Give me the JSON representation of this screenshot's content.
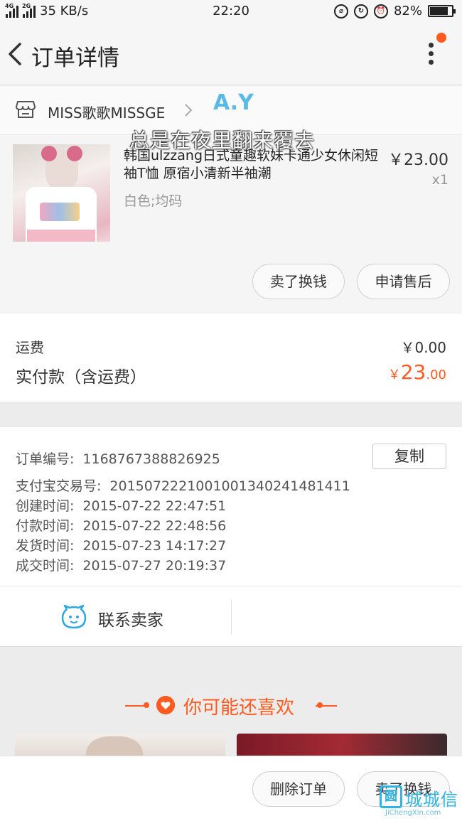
{
  "status_bar": {
    "network": "4G",
    "network2": "2G",
    "speed": "35 KB/s",
    "time": "22:20",
    "battery": "82%",
    "battery_level": 0.82
  },
  "nav": {
    "title": "订单详情"
  },
  "shop": {
    "name": "MISS歌歌MISSGE"
  },
  "watermark": {
    "brand": "A.Y",
    "caption": "总是在夜里翻来覆去",
    "site_cn": "城城信",
    "site_logo_char": "圆",
    "site_en": "JiChengXin.com"
  },
  "product": {
    "title": "韩国ulzzang日式童趣软妹卡通少女休闲短袖T恤 原宿小清新半袖潮",
    "price": "￥23.00",
    "qty": "x1",
    "variant": "白色;均码",
    "btn_sell": "卖了换钱",
    "btn_after_sale": "申请售后"
  },
  "totals": {
    "shipping_label": "运费",
    "shipping_value": "￥0.00",
    "paid_label": "实付款（含运费）",
    "paid_currency": "￥",
    "paid_int": "23",
    "paid_dec": ".00"
  },
  "order_info": {
    "copy_label": "复制",
    "rows": [
      {
        "label": "订单编号:",
        "value": "1168767388826925"
      },
      {
        "label": "支付宝交易号:",
        "value": "2015072221001001340241481411"
      },
      {
        "label": "创建时间:",
        "value": "2015-07-22 22:47:51"
      },
      {
        "label": "付款时间:",
        "value": "2015-07-22 22:48:56"
      },
      {
        "label": "发货时间:",
        "value": "2015-07-23 14:17:27"
      },
      {
        "label": "成交时间:",
        "value": "2015-07-27 20:19:37"
      }
    ]
  },
  "contact": {
    "label": "联系卖家"
  },
  "recommend": {
    "title": "你可能还喜欢"
  },
  "bottom_bar": {
    "delete_label": "删除订单",
    "sell_label": "卖了换钱"
  },
  "colors": {
    "accent": "#ff5a1f",
    "contact_icon": "#2aa8e0",
    "watermark_blue": "#5bb9e6"
  }
}
